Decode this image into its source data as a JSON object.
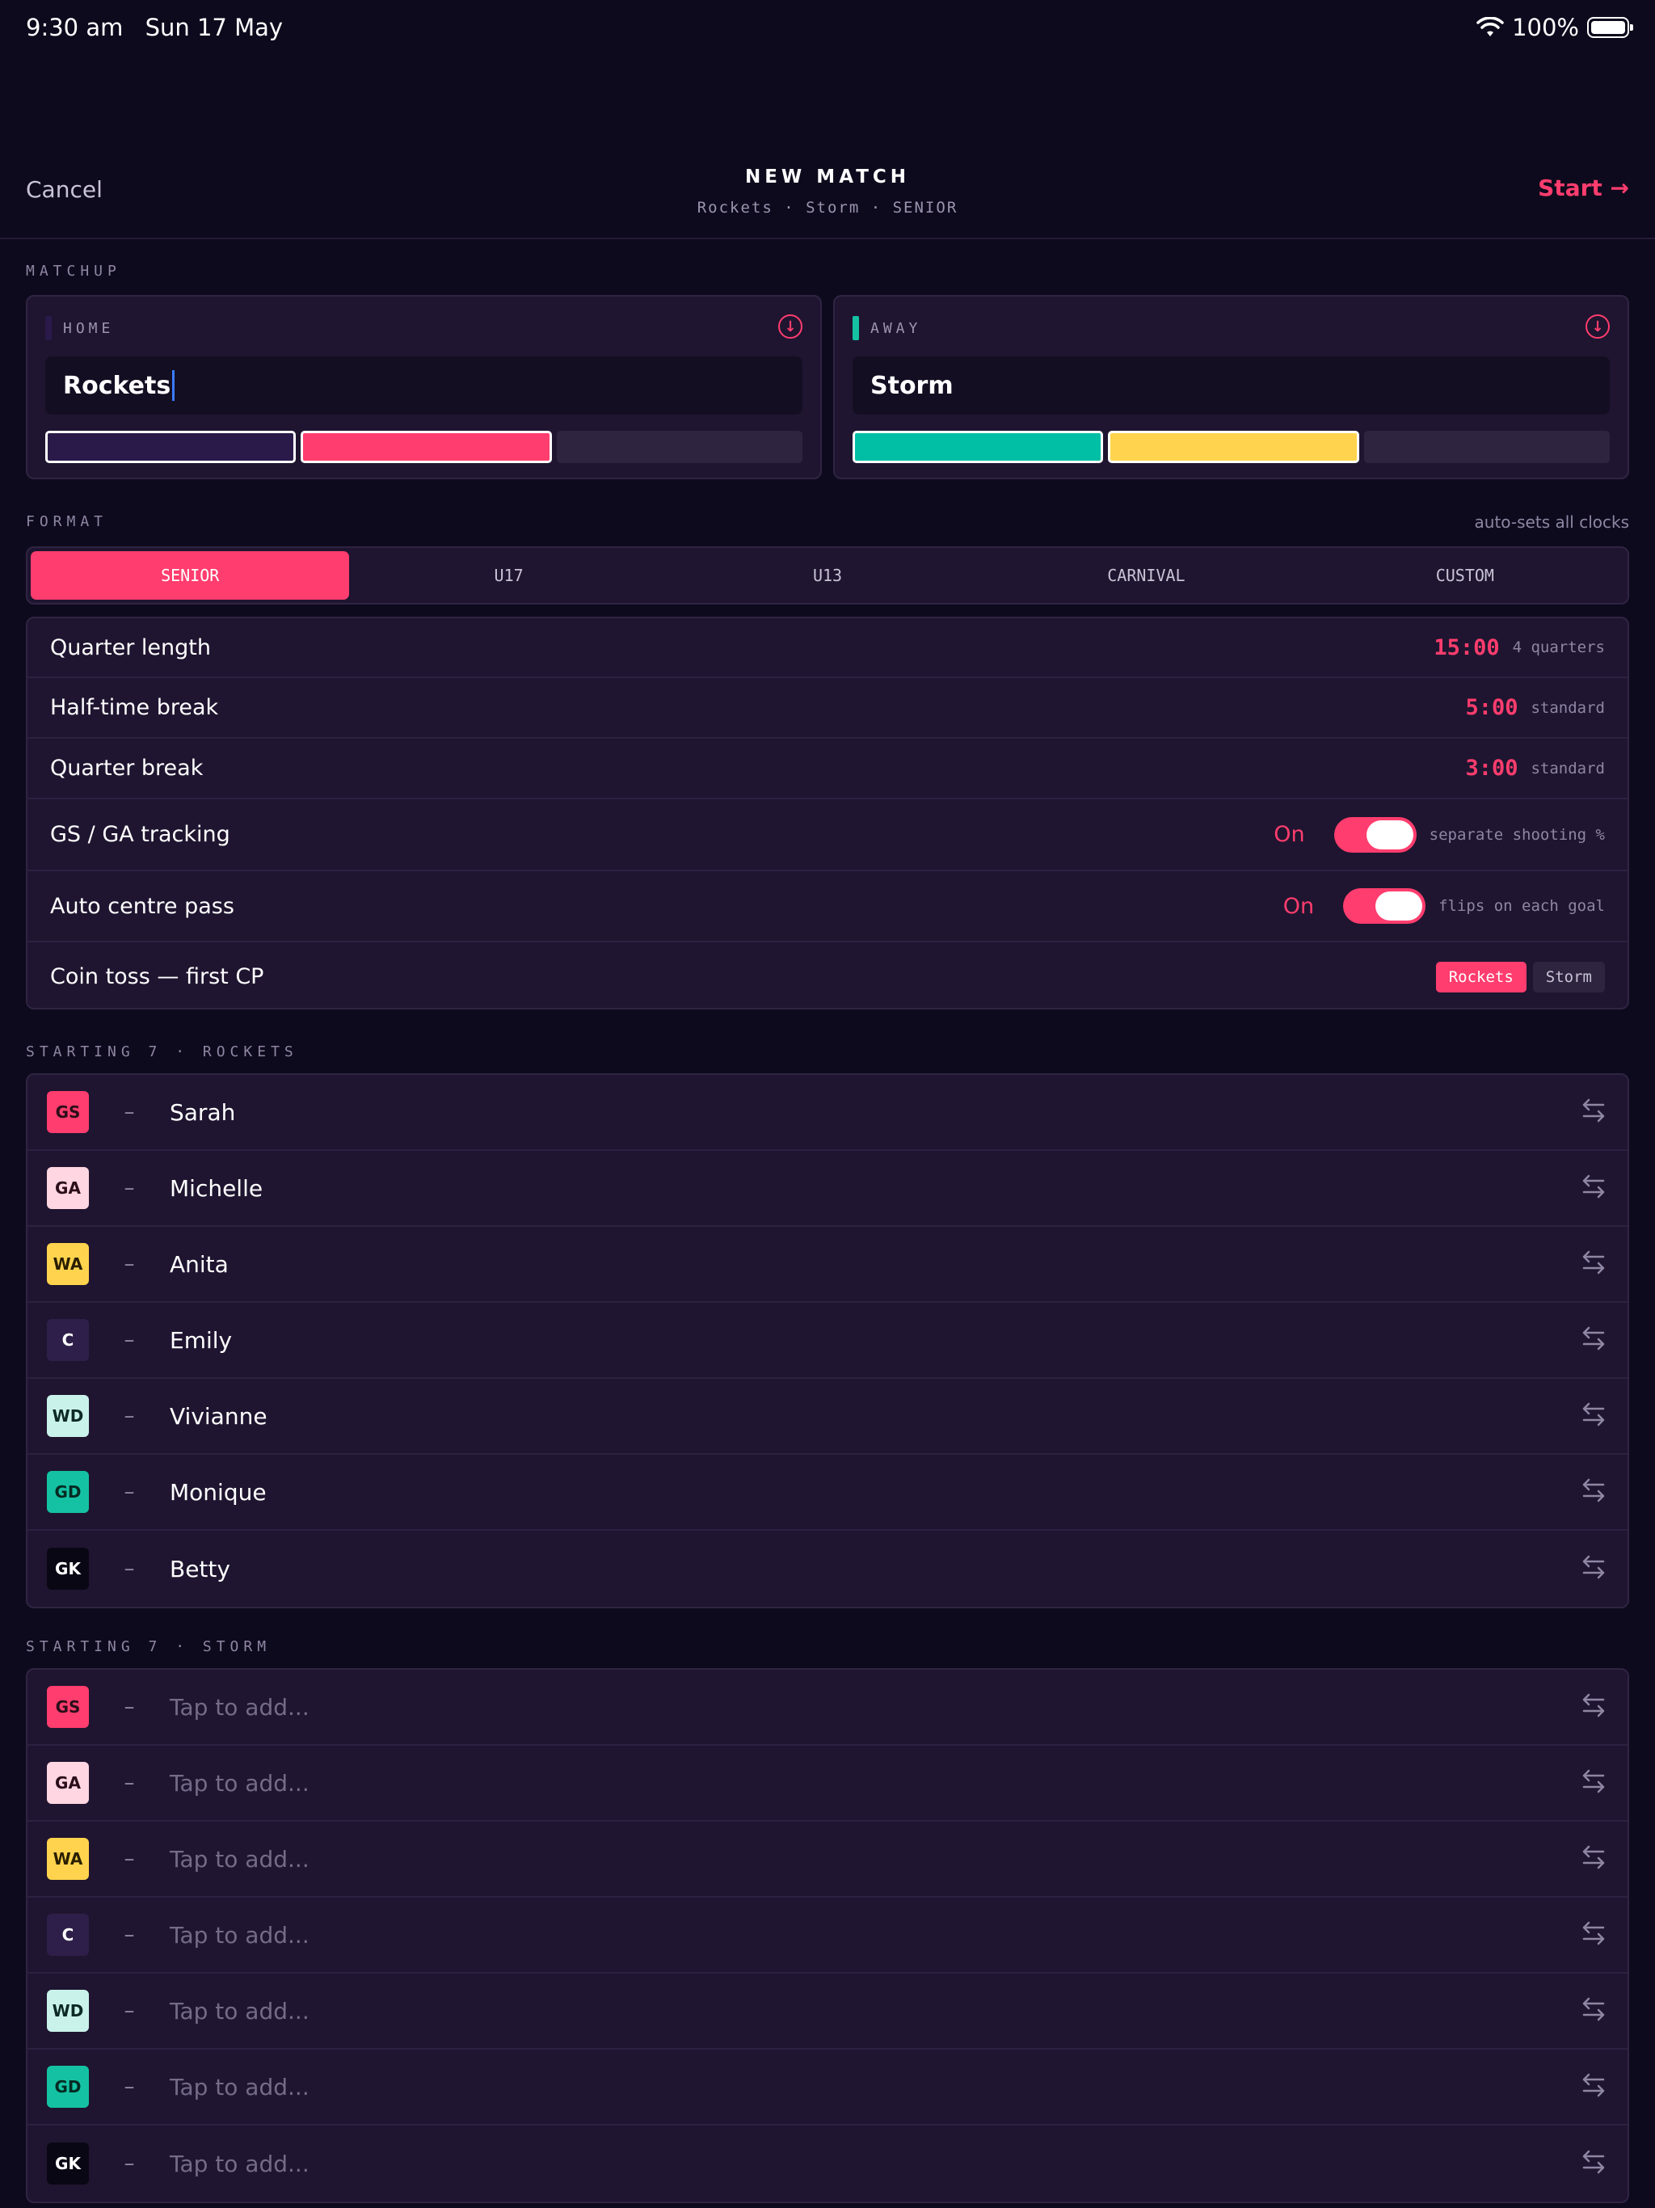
{
  "status": {
    "time": "9:30 am",
    "date": "Sun 17 May",
    "battery": "100%"
  },
  "nav": {
    "cancel": "Cancel",
    "title": "NEW MATCH",
    "subtitle": "Rockets · Storm · SENIOR",
    "start": "Start →"
  },
  "matchup": {
    "label": "MATCHUP",
    "home": {
      "tag": "HOME",
      "name": "Rockets",
      "accent": "#2a1a4a",
      "colors": [
        "#2a1a4a",
        "#ff3d6e",
        "#2e2440"
      ],
      "selected": [
        true,
        true,
        false
      ]
    },
    "away": {
      "tag": "AWAY",
      "name": "Storm",
      "accent": "#14c2a3",
      "colors": [
        "#00bfa5",
        "#ffd34d",
        "#2e2440"
      ],
      "selected": [
        true,
        true,
        false
      ]
    }
  },
  "format": {
    "label": "FORMAT",
    "note": "auto-sets all clocks",
    "tabs": [
      "SENIOR",
      "U17",
      "U13",
      "CARNIVAL",
      "CUSTOM"
    ],
    "active": "SENIOR"
  },
  "settings": {
    "quarter_length": {
      "label": "Quarter length",
      "value": "15:00",
      "note": "4 quarters"
    },
    "halftime": {
      "label": "Half-time break",
      "value": "5:00",
      "note": "standard"
    },
    "quarter_break": {
      "label": "Quarter break",
      "value": "3:00",
      "note": "standard"
    },
    "gs_ga": {
      "label": "GS / GA tracking",
      "state": "On",
      "note": "separate shooting %"
    },
    "auto_cp": {
      "label": "Auto centre pass",
      "state": "On",
      "note": "flips on each goal"
    },
    "coin_toss": {
      "label": "Coin toss — first CP",
      "options": [
        "Rockets",
        "Storm"
      ],
      "selected": "Rockets"
    }
  },
  "roster_home": {
    "label": "STARTING 7 · ROCKETS",
    "players": [
      {
        "pos": "GS",
        "name": "Sarah"
      },
      {
        "pos": "GA",
        "name": "Michelle"
      },
      {
        "pos": "WA",
        "name": "Anita"
      },
      {
        "pos": "C",
        "name": "Emily"
      },
      {
        "pos": "WD",
        "name": "Vivianne"
      },
      {
        "pos": "GD",
        "name": "Monique"
      },
      {
        "pos": "GK",
        "name": "Betty"
      }
    ]
  },
  "roster_away": {
    "label": "STARTING 7 · STORM",
    "placeholder": "Tap to add...",
    "positions": [
      "GS",
      "GA",
      "WA",
      "C",
      "WD",
      "GD",
      "GK"
    ]
  },
  "dash": "–",
  "position_colors": {
    "GS": {
      "bg": "#ff3d6e",
      "fg": "#2a0f1a"
    },
    "GA": {
      "bg": "#ffd6e1",
      "fg": "#2a0f1a"
    },
    "WA": {
      "bg": "#ffd34d",
      "fg": "#2a1f00"
    },
    "C": {
      "bg": "#2e1f4a",
      "fg": "#ffffff"
    },
    "WD": {
      "bg": "#c9f2ea",
      "fg": "#0d2a25"
    },
    "GD": {
      "bg": "#14c2a3",
      "fg": "#062a23"
    },
    "GK": {
      "bg": "#0a0714",
      "fg": "#ffffff"
    }
  }
}
